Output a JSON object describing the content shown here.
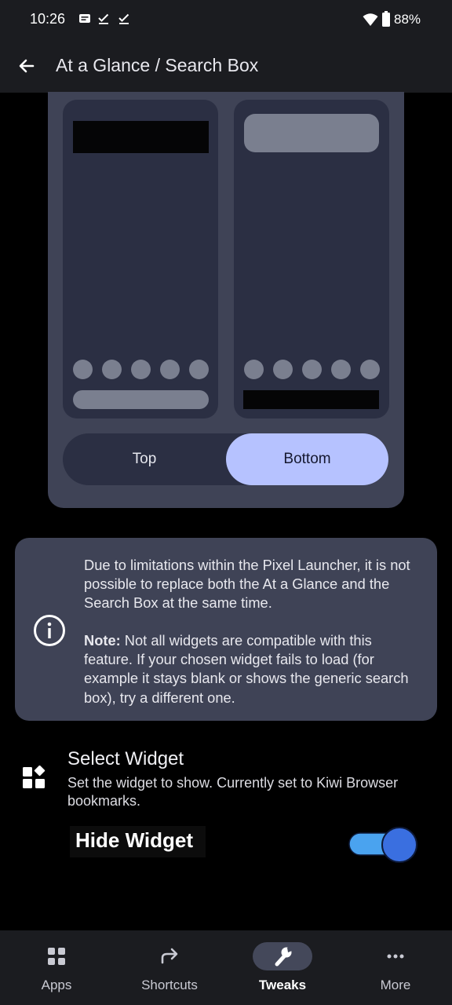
{
  "status_bar": {
    "time": "10:26",
    "battery_percent": "88%",
    "icons": [
      "message-icon",
      "check-icon",
      "check-icon",
      "wifi-icon",
      "battery-icon"
    ]
  },
  "app_bar": {
    "title": "At a Glance / Search Box",
    "back_icon": "arrow-back-icon"
  },
  "position_toggle": {
    "options": [
      "Top",
      "Bottom"
    ],
    "selected": "Bottom"
  },
  "info_card": {
    "icon": "info-icon",
    "paragraph1": "Due to limitations within the Pixel Launcher, it is not possible to replace both the At a Glance and the Search Box at the same time.",
    "note_label": "Note:",
    "note_text": " Not all widgets are compatible with this feature. If your chosen widget fails to load (for example it stays blank or shows the generic search box), try a different one."
  },
  "select_widget": {
    "icon": "widgets-icon",
    "title": "Select Widget",
    "description": "Set the widget to show. Currently set to Kiwi Browser bookmarks."
  },
  "hide_widget": {
    "label": "Hide Widget",
    "enabled": true
  },
  "bottom_nav": {
    "items": [
      {
        "label": "Apps",
        "icon": "apps-grid-icon"
      },
      {
        "label": "Shortcuts",
        "icon": "shortcut-arrow-icon"
      },
      {
        "label": "Tweaks",
        "icon": "wrench-icon"
      },
      {
        "label": "More",
        "icon": "more-dots-icon"
      }
    ],
    "selected": "Tweaks"
  },
  "colors": {
    "background": "#000000",
    "surface": "#3f4356",
    "accent": "#b6c2ff",
    "toggle_on": "#3f6fe0"
  }
}
